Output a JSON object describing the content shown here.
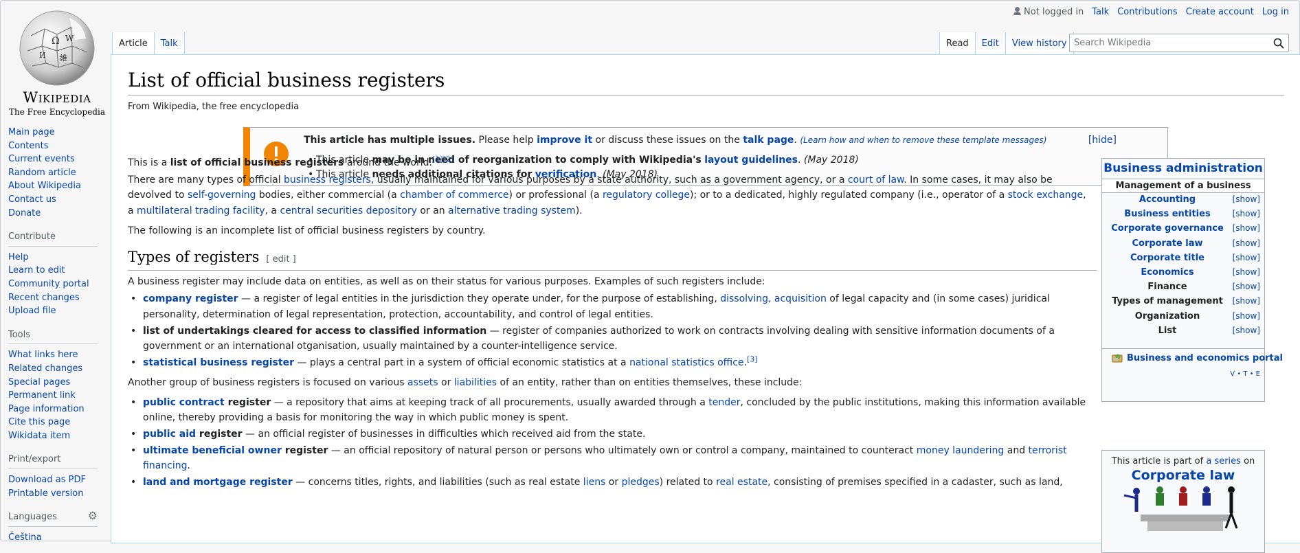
{
  "logo": {
    "wordmark": "Wikipedia",
    "tagline": "The Free Encyclopedia"
  },
  "sidebar": {
    "main": [
      "Main page",
      "Contents",
      "Current events",
      "Random article",
      "About Wikipedia",
      "Contact us",
      "Donate"
    ],
    "contribute": {
      "heading": "Contribute",
      "items": [
        "Help",
        "Learn to edit",
        "Community portal",
        "Recent changes",
        "Upload file"
      ]
    },
    "tools": {
      "heading": "Tools",
      "items": [
        "What links here",
        "Related changes",
        "Special pages",
        "Permanent link",
        "Page information",
        "Cite this page",
        "Wikidata item"
      ]
    },
    "print": {
      "heading": "Print/export",
      "items": [
        "Download as PDF",
        "Printable version"
      ]
    },
    "languages": {
      "heading": "Languages",
      "items": [
        "Čeština"
      ]
    }
  },
  "personal": {
    "not_logged_in": "Not logged in",
    "talk": "Talk",
    "contributions": "Contributions",
    "create_account": "Create account",
    "login": "Log in"
  },
  "tabs": {
    "article": "Article",
    "talk": "Talk",
    "read": "Read",
    "edit": "Edit",
    "history": "View history"
  },
  "search": {
    "placeholder": "Search Wikipedia"
  },
  "article": {
    "title": "List of official business registers",
    "from": "From Wikipedia, the free encyclopedia"
  },
  "ambox": {
    "bold": "This article has multiple issues.",
    "please": " Please help ",
    "improve": "improve it",
    "discuss": " or discuss these issues on the ",
    "talkpage": "talk page",
    "learn": "(Learn how and when to remove these template messages)",
    "hide": "[hide]",
    "issue1_a": "This article ",
    "issue1_b": "may be in need of reorganization to comply with Wikipedia's",
    "issue1_link": "layout guidelines",
    "issue1_date": "(May 2018)",
    "issue2_a": "This article ",
    "issue2_b": "needs additional citations for",
    "issue2_link": "verification",
    "issue2_date": "(May 2018)"
  },
  "body": {
    "intro_a": "This is a ",
    "intro_b": "list of official business registers",
    "intro_c": " around the world.",
    "intro_refs": "[1][2]",
    "p2_l1_a": "There are many types of official ",
    "p2_l1_link1": "business registers",
    "p2_l1_b": ", usually maintained for various purposes by a state authority, such as a government agency, or a ",
    "p2_l1_link2": "court of law",
    "p2_l1_c": ". In some cases, it may also be",
    "p2_l2_a": "devolved to ",
    "p2_l2_link1": "self-governing",
    "p2_l2_b": " bodies, either commercial (a ",
    "p2_l2_link2": "chamber of commerce",
    "p2_l2_c": ") or professional (a ",
    "p2_l2_link3": "regulatory college",
    "p2_l2_d": "); or to a dedicated, highly regulated company (i.e., operator of a ",
    "p2_l2_link4": "stock exchange",
    "p2_l2_e": ",",
    "p2_l3_a": "a ",
    "p2_l3_link1": "multilateral trading facility",
    "p2_l3_b": ", a ",
    "p2_l3_link2": "central securities depository",
    "p2_l3_c": " or an ",
    "p2_l3_link3": "alternative trading system",
    "p2_l3_d": ").",
    "p3": "The following is an incomplete list of official business registers by country.",
    "h2_types": "Types of registers",
    "edit": "[ edit ]",
    "types_intro": "A business register may include data on entities, as well as on their status for various purposes. Examples of such registers include:",
    "b1_term": "company register",
    "b1_a": " — a register of legal entities in the jurisdiction they operate under, for the purpose of establishing, ",
    "b1_link1": "dissolving",
    "b1_comma": ", ",
    "b1_link2": "acquisition",
    "b1_b": " of legal capacity and (in some cases) juridical",
    "b1_l2": "personality, determination of legal representation, protection, accountability, and control of legal entities.",
    "b2_term": "list of undertakings cleared for access to classified information",
    "b2_a": " — register of companies authorized to work on contracts involving dealing with sensitive information documents of a",
    "b2_l2": "government or an international otganisation, usually maintained by a counter-intelligence service.",
    "b3_term": "statistical business register",
    "b3_a": " — plays a central part in a system of official economic statistics at a ",
    "b3_link": "national statistics office",
    "b3_b": ".",
    "b3_ref": "[3]",
    "group2_a": "Another group of business registers is focused on various ",
    "group2_link1": "assets",
    "group2_b": " or ",
    "group2_link2": "liabilities",
    "group2_c": " of an entity, rather than on entities themselves, these include:",
    "c1_term": "public contract",
    "c1_term2": " register",
    "c1_a": " — a repository that aims at keeping track of all procurements, usually awarded through a ",
    "c1_link": "tender",
    "c1_b": ", concluded by the public institutions, making this information available",
    "c1_l2": "online, thereby providing a basis for monitoring the way in which public money is spent.",
    "c2_term": "public aid",
    "c2_term2": " register",
    "c2_a": " — an official register of businesses in difficulties which received aid from the state.",
    "c3_term": "ultimate beneficial owner",
    "c3_term2": " register",
    "c3_a": " — an official repository of natural person or persons who ultimately own or control a company, maintained to counteract ",
    "c3_link1": "money laundering",
    "c3_b": " and ",
    "c3_link2": "terrorist",
    "c3_l2": "financing",
    "c3_l2b": ".",
    "c4_term": "land and mortgage register",
    "c4_a": " — concerns titles, rights, and liabilities (such as real estate ",
    "c4_link1": "liens",
    "c4_b": " or ",
    "c4_link2": "pledges",
    "c4_c": ") related to ",
    "c4_link3": "real estate",
    "c4_d": ", consisting of premises specified in a cadaster, such as land,"
  },
  "navbox": {
    "title": "Business administration",
    "subtitle": "Management of a business",
    "rows": [
      {
        "label": "Accounting",
        "link": true
      },
      {
        "label": "Business entities",
        "link": true
      },
      {
        "label": "Corporate governance",
        "link": true
      },
      {
        "label": "Corporate law",
        "link": true
      },
      {
        "label": "Corporate title",
        "link": true
      },
      {
        "label": "Economics",
        "link": true
      },
      {
        "label": "Finance",
        "link": false
      },
      {
        "label": "Types of management",
        "link": false
      },
      {
        "label": "Organization",
        "link": false
      },
      {
        "label": "List",
        "link": false
      }
    ],
    "show": "[show]",
    "portal": "Business and economics portal",
    "vte": "V • T • E"
  },
  "series": {
    "text_a": "This article is part of ",
    "text_link": "a series",
    "text_b": " on",
    "title": "Corporate law"
  },
  "colors": {
    "link": "#0645ad",
    "ambox_accent": "#f28500",
    "border": "#a2a9b1"
  }
}
